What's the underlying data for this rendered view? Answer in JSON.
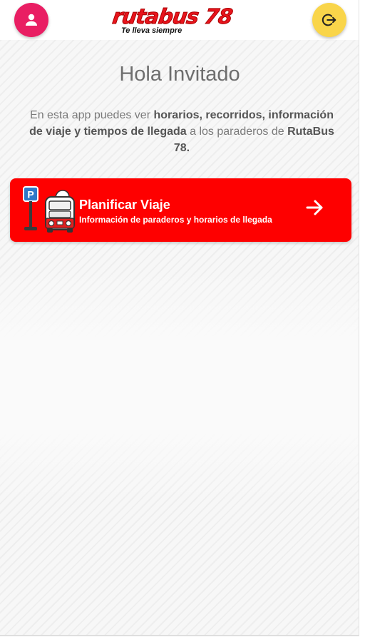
{
  "header": {
    "logo_text": "rutabus 78",
    "logo_tagline": "Te lleva siempre",
    "profile_icon": "person-icon",
    "logout_icon": "logout-icon"
  },
  "greeting": "Hola Invitado",
  "intro": {
    "part1": "En esta app puedes ver ",
    "bold1": "horarios, recorridos, información de viaje y tiempos de llegada",
    "part2": " a los paraderos de ",
    "bold2": "RutaBus 78."
  },
  "card": {
    "title": "Planificar Viaje",
    "subtitle": "Información de paraderos y horarios de llegada",
    "illustration_icon": "bus-stop-icon",
    "arrow_icon": "arrow-right-icon",
    "stop_sign_letter": "P"
  },
  "colors": {
    "primary_red": "#fe0000",
    "profile_pink": "#e91e63",
    "logout_yellow": "#f9d54a",
    "greeting_gray": "#6e6e6e"
  }
}
